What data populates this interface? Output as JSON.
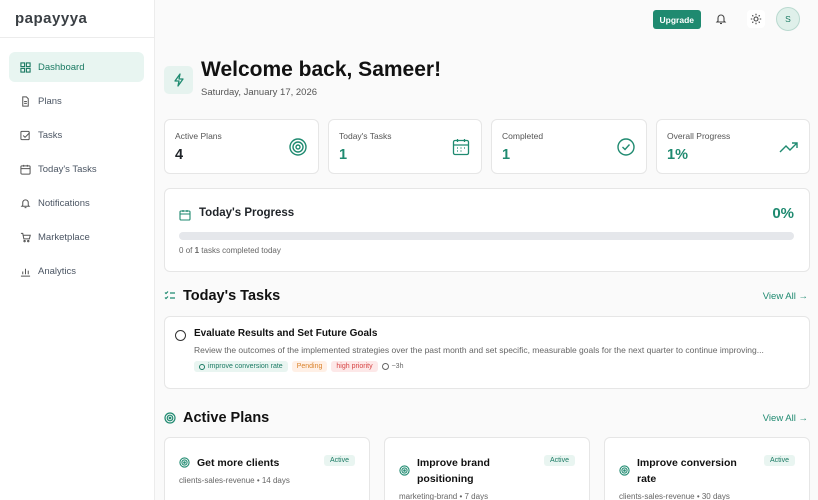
{
  "app": {
    "logo": "papayyya"
  },
  "sidebar": {
    "items": [
      {
        "label": "Dashboard",
        "icon": "grid-icon",
        "active": true
      },
      {
        "label": "Plans",
        "icon": "document-icon"
      },
      {
        "label": "Tasks",
        "icon": "check-square-icon"
      },
      {
        "label": "Today's Tasks",
        "icon": "calendar-icon"
      },
      {
        "label": "Notifications",
        "icon": "bell-icon"
      },
      {
        "label": "Marketplace",
        "icon": "cart-icon"
      },
      {
        "label": "Analytics",
        "icon": "bar-chart-icon"
      }
    ]
  },
  "topbar": {
    "upgrade_label": "Upgrade",
    "avatar_initial": "S"
  },
  "header": {
    "title": "Welcome back, Sameer!",
    "date": "Saturday, January 17, 2026"
  },
  "stats": [
    {
      "label": "Active Plans",
      "value": "4",
      "icon": "target-icon"
    },
    {
      "label": "Today's Tasks",
      "value": "1",
      "icon": "calendar-icon"
    },
    {
      "label": "Completed",
      "value": "1",
      "icon": "check-circle-icon"
    },
    {
      "label": "Overall Progress",
      "value": "1%",
      "icon": "trending-up-icon"
    }
  ],
  "progress": {
    "title": "Today's Progress",
    "percent_label": "0%",
    "fill_percent": 0,
    "count": "0",
    "sub_of": "of",
    "total": "1",
    "sub_suffix": "tasks completed today"
  },
  "todays_tasks": {
    "title": "Today's Tasks",
    "view_all": "View All →",
    "items": [
      {
        "title": "Evaluate Results and Set Future Goals",
        "description": "Review the outcomes of the implemented strategies over the past month and set specific, measurable goals for the next quarter to continue improving...",
        "plan_tag": "improve conversion rate",
        "status": "Pending",
        "priority": "high priority",
        "time": "~3h"
      }
    ]
  },
  "active_plans": {
    "title": "Active Plans",
    "view_all": "View All →",
    "items": [
      {
        "title": "Get more clients",
        "badge": "Active",
        "meta": "clients-sales-revenue • 14 days"
      },
      {
        "title": "Improve brand positioning",
        "badge": "Active",
        "meta": "marketing-brand • 7 days"
      },
      {
        "title": "Improve conversion rate",
        "badge": "Active",
        "meta": "clients-sales-revenue • 30 days"
      }
    ]
  },
  "colors": {
    "accent": "#1f8a70",
    "accent_light": "#e8f5f1",
    "pending": "#d9822b",
    "high": "#d64545"
  }
}
